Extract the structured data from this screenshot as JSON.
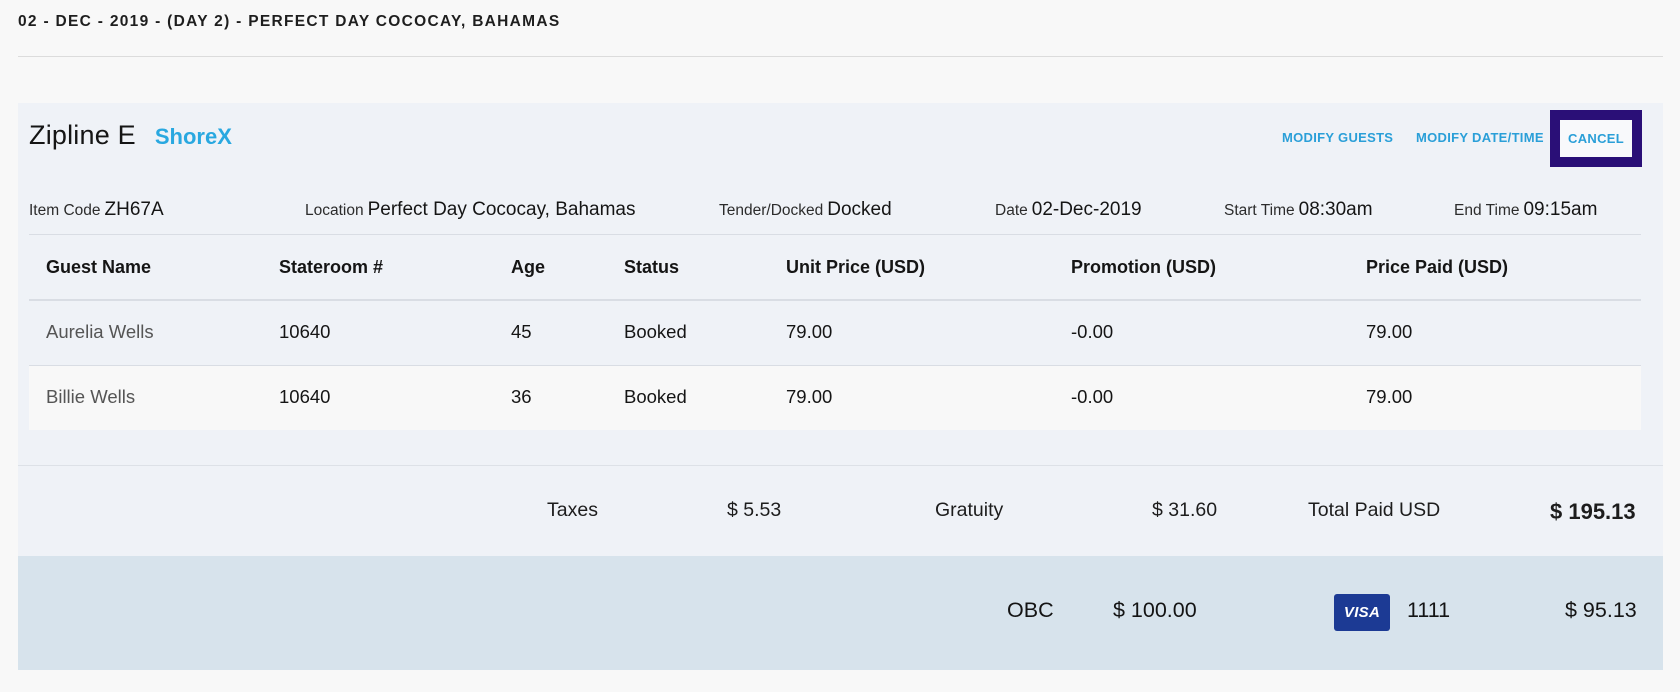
{
  "day_header": "02 - DEC - 2019 - (DAY 2) - PERFECT DAY COCOCAY, BAHAMAS",
  "item": {
    "title": "Zipline E",
    "category": "ShoreX"
  },
  "actions": {
    "modify_guests": "MODIFY GUESTS",
    "modify_date_time": "MODIFY DATE/TIME",
    "cancel": "CANCEL"
  },
  "meta": {
    "item_code_label": "Item Code",
    "item_code": "ZH67A",
    "location_label": "Location",
    "location": "Perfect Day Cococay, Bahamas",
    "tender_label": "Tender/Docked",
    "tender": "Docked",
    "date_label": "Date",
    "date": "02-Dec-2019",
    "start_label": "Start Time",
    "start": "08:30am",
    "end_label": "End Time",
    "end": "09:15am"
  },
  "table": {
    "headers": [
      "Guest Name",
      "Stateroom #",
      "Age",
      "Status",
      "Unit Price (USD)",
      "Promotion (USD)",
      "Price Paid (USD)"
    ],
    "rows": [
      [
        "Aurelia Wells",
        "10640",
        "45",
        "Booked",
        "79.00",
        "-0.00",
        "79.00"
      ],
      [
        "Billie Wells",
        "10640",
        "36",
        "Booked",
        "79.00",
        "-0.00",
        "79.00"
      ]
    ]
  },
  "summary": {
    "taxes_label": "Taxes",
    "taxes": "$ 5.53",
    "gratuity_label": "Gratuity",
    "gratuity": "$ 31.60",
    "total_label": "Total Paid USD",
    "total": "$ 195.13"
  },
  "payment": {
    "obc_label": "OBC",
    "obc_amount": "$ 100.00",
    "card_brand": "VISA",
    "card_last4": "1111",
    "card_amount": "$ 95.13"
  },
  "colors": {
    "accent": "#29a8e0",
    "cancel_outline": "#2a0f77",
    "visa": "#1c3a94"
  }
}
